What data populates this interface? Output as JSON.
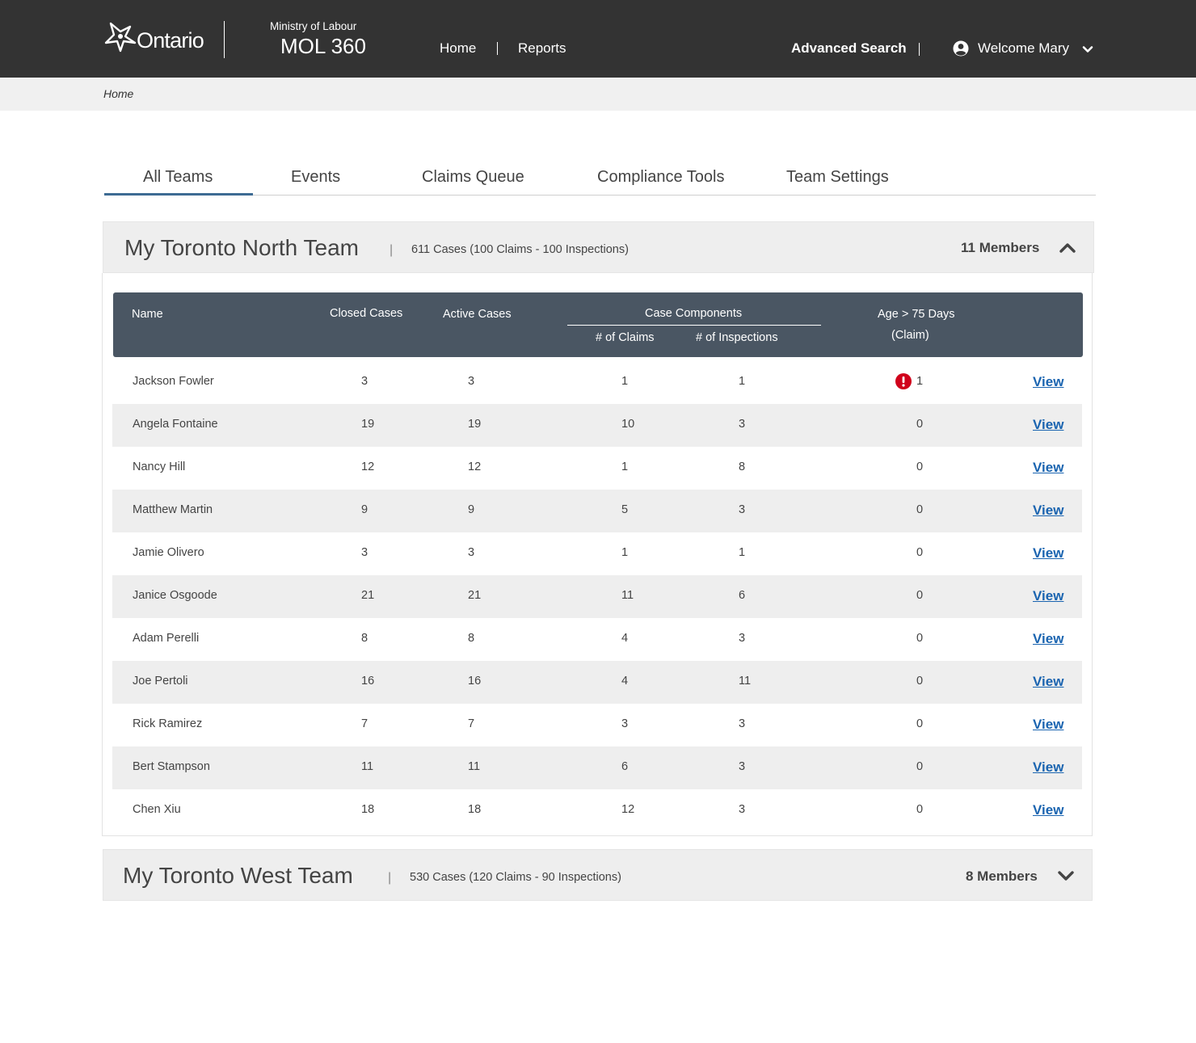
{
  "header": {
    "logo_text": "Ontario",
    "ministry": "Ministry of Labour",
    "app_name": "MOL 360",
    "nav": [
      "Home",
      "Reports"
    ],
    "advanced_search": "Advanced Search",
    "welcome": "Welcome Mary"
  },
  "breadcrumb": "Home",
  "tabs": [
    "All Teams",
    "Events",
    "Claims Queue",
    "Compliance Tools",
    "Team Settings"
  ],
  "colors": {
    "header_bg": "#333333",
    "table_header_bg": "#4a5663",
    "active_tab": "#3d6b93",
    "link": "#1a64b0",
    "alert": "#d0021b"
  },
  "teams": [
    {
      "name": "My Toronto North Team",
      "summary": "611 Cases (100 Claims - 100 Inspections)",
      "members": "11 Members",
      "expanded": true
    },
    {
      "name": "My Toronto West Team",
      "summary": "530 Cases (120 Claims - 90 Inspections)",
      "members": "8 Members",
      "expanded": false
    }
  ],
  "table": {
    "headers": {
      "name": "Name",
      "closed": "Closed Cases",
      "active": "Active Cases",
      "components": "Case Components",
      "claims": "# of Claims",
      "inspections": "# of Inspections",
      "age_line1": "Age > 75 Days",
      "age_line2": "(Claim)"
    },
    "view_label": "View",
    "rows": [
      {
        "name": "Jackson Fowler",
        "closed": "3",
        "active": "3",
        "claims": "1",
        "inspections": "1",
        "age": "1",
        "alert": true
      },
      {
        "name": "Angela Fontaine",
        "closed": "19",
        "active": "19",
        "claims": "10",
        "inspections": "3",
        "age": "0",
        "alert": false
      },
      {
        "name": "Nancy Hill",
        "closed": "12",
        "active": "12",
        "claims": "1",
        "inspections": "8",
        "age": "0",
        "alert": false
      },
      {
        "name": "Matthew Martin",
        "closed": "9",
        "active": "9",
        "claims": "5",
        "inspections": "3",
        "age": "0",
        "alert": false
      },
      {
        "name": "Jamie Olivero",
        "closed": "3",
        "active": "3",
        "claims": "1",
        "inspections": "1",
        "age": "0",
        "alert": false
      },
      {
        "name": "Janice Osgoode",
        "closed": "21",
        "active": "21",
        "claims": "11",
        "inspections": "6",
        "age": "0",
        "alert": false
      },
      {
        "name": "Adam Perelli",
        "closed": "8",
        "active": "8",
        "claims": "4",
        "inspections": "3",
        "age": "0",
        "alert": false
      },
      {
        "name": "Joe Pertoli",
        "closed": "16",
        "active": "16",
        "claims": "4",
        "inspections": "11",
        "age": "0",
        "alert": false
      },
      {
        "name": "Rick Ramirez",
        "closed": "7",
        "active": "7",
        "claims": "3",
        "inspections": "3",
        "age": "0",
        "alert": false
      },
      {
        "name": "Bert Stampson",
        "closed": "11",
        "active": "11",
        "claims": "6",
        "inspections": "3",
        "age": "0",
        "alert": false
      },
      {
        "name": "Chen Xiu",
        "closed": "18",
        "active": "18",
        "claims": "12",
        "inspections": "3",
        "age": "0",
        "alert": false
      }
    ]
  }
}
